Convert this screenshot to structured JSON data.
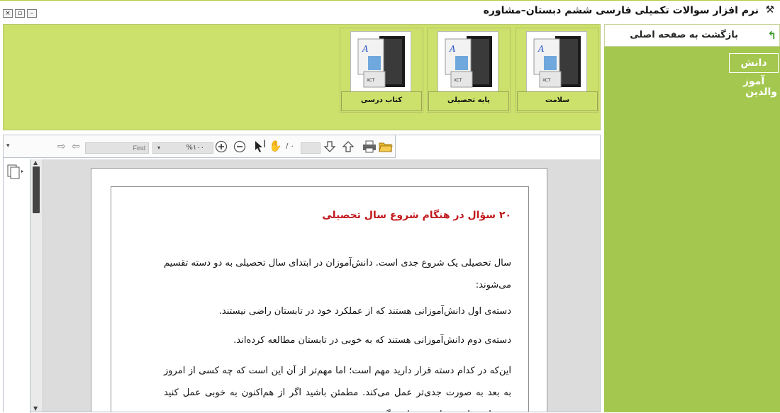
{
  "window": {
    "title": "نرم افزار سوالات تکمیلی فارسی ششم دبستان–مشاوره",
    "buttons": {
      "minimize": "–",
      "restore": "▫",
      "close": "×"
    }
  },
  "sidebar": {
    "back_label": "بازگشت به صفحه اصلی",
    "items": [
      {
        "label": "دانش آموز"
      },
      {
        "label": "والدین"
      }
    ]
  },
  "topics": [
    {
      "label": "سلامت"
    },
    {
      "label": "پایه تحصیلی"
    },
    {
      "label": "کتاب درسی"
    }
  ],
  "viewer_toolbar": {
    "find_placeholder": "Find",
    "zoom_value": "%۱۰۰",
    "page_total": "/ ۰"
  },
  "document": {
    "title": "۲۰ سؤال در هنگام شروع سال تحصیلی",
    "paragraphs": [
      "سال تحصیلی یک شروع جدی است. دانش‌آموزان در ابتدای سال تحصیلی به دو دسته تقسیم می‌شوند:",
      "دسته‌ی اول دانش‌آموزانی هستند که از عملکرد خود در تابستان راضی نیستند.",
      "دسته‌ی دوم دانش‌آموزانی هستند که به خوبی در تابستان مطالعه کرده‌اند.",
      "این‌که در کدام دسته قرار دارید مهم است؛ اما مهم‌تر از آن این است که چه کسی از امروز به بعد به صورت جدی‌تر عمل می‌کند. مطمئن باشید اگر از هم‌اکنون به خوبی عمل کنید می‌توانید نتایج بسیار درخشانی بگیرید."
    ]
  },
  "colors": {
    "sidebar_bg": "#a4c84f",
    "topics_bg": "#cce06c",
    "title_red": "#c0181c"
  }
}
